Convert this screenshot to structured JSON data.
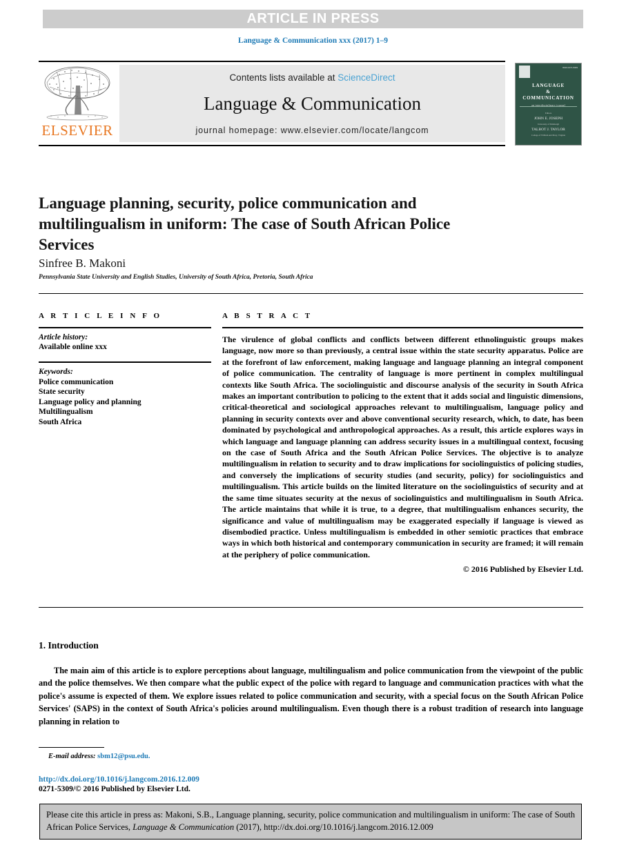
{
  "header": {
    "article_in_press": "ARTICLE IN PRESS",
    "running_head": "Language & Communication xxx (2017) 1–9"
  },
  "journal_header": {
    "contents_prefix": "Contents lists available at ",
    "sciencedirect": "ScienceDirect",
    "journal_title": "Language & Communication",
    "homepage": "journal homepage: www.elsevier.com/locate/langcom",
    "publisher_name": "ELSEVIER",
    "cover": {
      "issn_note": "ISSN 0271-5309",
      "title_line1": "LANGUAGE",
      "title_line2": "&",
      "title_line3": "COMMUNICATION",
      "subtitle": "an interdisciplinary journal",
      "editors_label": "Editors",
      "editor1": "JOHN E. JOSEPH",
      "editor1_aff": "University of Edinburgh",
      "editor2": "TALBOT J. TAYLOR",
      "editor2_aff": "College of William and Mary, Virginia"
    }
  },
  "article": {
    "title": "Language planning, security, police communication and multilingualism in uniform: The case of South African Police Services",
    "author": "Sinfree B. Makoni",
    "affiliation": "Pennsylvania State University and English Studies, University of South Africa, Pretoria, South Africa"
  },
  "article_info": {
    "heading": "A R T I C L E   I N F O",
    "history_label": "Article history:",
    "history_value": "Available online xxx",
    "keywords_label": "Keywords:",
    "keywords": [
      "Police communication",
      "State security",
      "Language policy and planning",
      "Multilingualism",
      "South Africa"
    ]
  },
  "abstract": {
    "heading": "A B S T R A C T",
    "body": "The virulence of global conflicts and conflicts between different ethnolinguistic groups makes language, now more so than previously, a central issue within the state security apparatus. Police are at the forefront of law enforcement, making language and language planning an integral component of police communication. The centrality of language is more pertinent in complex multilingual contexts like South Africa. The sociolinguistic and discourse analysis of the security in South Africa makes an important contribution to policing to the extent that it adds social and linguistic dimensions, critical-theoretical and sociological approaches relevant to multilingualism, language policy and planning in security contexts over and above conventional security research, which, to date, has been dominated by psychological and anthropological approaches. As a result, this article explores ways in which language and language planning can address security issues in a multilingual context, focusing on the case of South Africa and the South African Police Services. The objective is to analyze multilingualism in relation to security and to draw implications for sociolinguistics of policing studies, and conversely the implications of security studies (and security, policy) for sociolinguistics and multilingualism. This article builds on the limited literature on the sociolinguistics of security and at the same time situates security at the nexus of sociolinguistics and multilingualism in South Africa. The article maintains that while it is true, to a degree, that multilingualism enhances security, the significance and value of multilingualism may be exaggerated especially if language is viewed as disembodied practice. Unless multilingualism is embedded in other semiotic practices that embrace ways in which both historical and contemporary communication in security are framed; it will remain at the periphery of police communication.",
    "copyright": "© 2016 Published by Elsevier Ltd."
  },
  "introduction": {
    "heading": "1. Introduction",
    "paragraph": "The main aim of this article is to explore perceptions about language, multilingualism and police communication from the viewpoint of the public and the police themselves. We then compare what the public expect of the police with regard to language and communication practices with what the police's assume is expected of them. We explore issues related to police communication and security, with a special focus on the South African Police Services' (SAPS) in the context of South Africa's policies around multilingualism. Even though there is a robust tradition of research into language planning in relation to"
  },
  "footer": {
    "email_label": "E-mail address:",
    "email_value": "sbm12@psu.edu.",
    "doi": "http://dx.doi.org/10.1016/j.langcom.2016.12.009",
    "issn_line": "0271-5309/© 2016 Published by Elsevier Ltd."
  },
  "citation": {
    "part1": "Please cite this article in press as: Makoni, S.B., Language planning, security, police communication and multilingualism in uniform: The case of South African Police Services, ",
    "journal_italic": "Language & Communication",
    "part2": " (2017), http://dx.doi.org/10.1016/j.langcom.2016.12.009"
  },
  "colors": {
    "link_blue": "#1f7bb6",
    "sciencedirect_blue": "#4ba3d3",
    "elsevier_orange": "#e87722",
    "cover_green": "#2f5446",
    "bar_gray": "#cccccc",
    "box_gray": "#e8e8e8",
    "citation_gray": "#c6c6c6"
  }
}
